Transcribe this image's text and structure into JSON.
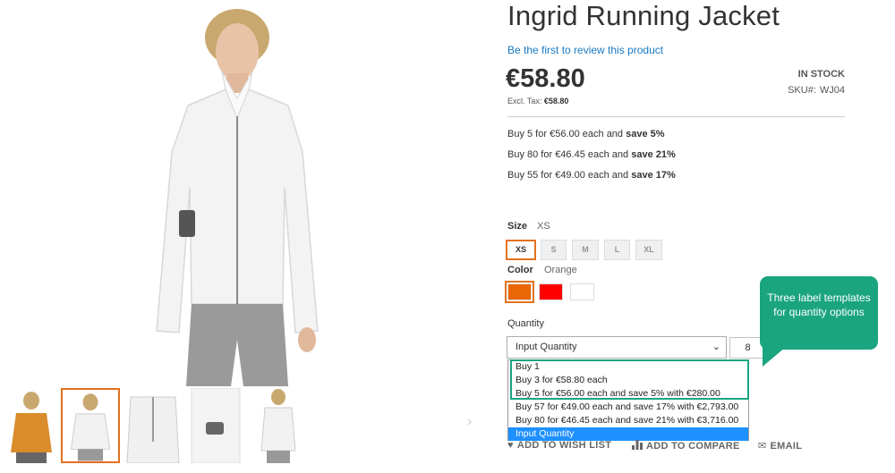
{
  "product": {
    "title": "Ingrid Running Jacket",
    "review_link": "Be the first to review this product",
    "price": "€58.80",
    "excl_label": "Excl. Tax:",
    "excl_value": "€58.80",
    "stock": "IN STOCK",
    "sku_label": "SKU#:",
    "sku_value": "WJ04"
  },
  "tier_prices": [
    {
      "text": "Buy 5 for €56.00 each and ",
      "bold": "save 5%"
    },
    {
      "text": "Buy 80 for €46.45 each and ",
      "bold": "save 21%"
    },
    {
      "text": "Buy 55 for €49.00 each and ",
      "bold": "save 17%"
    }
  ],
  "size": {
    "label": "Size",
    "selected": "XS",
    "options": [
      "XS",
      "S",
      "M",
      "L",
      "XL"
    ]
  },
  "color": {
    "label": "Color",
    "selected": "Orange",
    "options": [
      {
        "name": "Orange",
        "hex": "#eb6703"
      },
      {
        "name": "Red",
        "hex": "#ff0000"
      },
      {
        "name": "White",
        "hex": "#ffffff"
      }
    ]
  },
  "quantity": {
    "label": "Quantity",
    "select_value": "Input Quantity",
    "input_value": "8",
    "dropdown_options": [
      "Buy 1",
      "Buy 3 for €58.80 each",
      "Buy 5 for €56.00 each and save 5% with €280.00",
      "Buy 57 for €49.00 each and save 17% with €2,793.00",
      "Buy 80 for €46.45 each and save 21% with €3,716.00",
      "Input Quantity"
    ],
    "highlighted_option": "Input Quantity"
  },
  "callout": {
    "text": "Three label templates for quantity options"
  },
  "actions": {
    "wishlist": "ADD TO WISH LIST",
    "compare": "ADD TO COMPARE",
    "email": "EMAIL"
  },
  "icons": {
    "wishlist": "heart-icon",
    "compare": "bar-chart-icon",
    "email": "envelope-icon",
    "next": "chevron-right-icon"
  },
  "colors": {
    "accent": "#e3711f",
    "link": "#1979c3",
    "callout": "#1aa57f",
    "highlight": "#1e90ff"
  }
}
